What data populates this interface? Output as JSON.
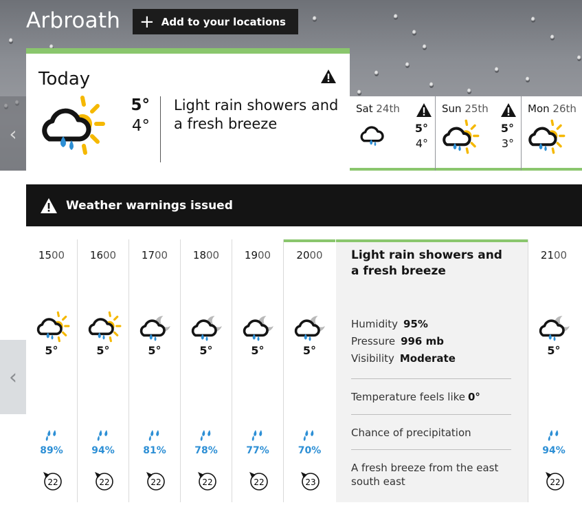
{
  "location": {
    "name": "Arbroath",
    "add_label": "Add to your locations"
  },
  "today": {
    "label": "Today",
    "high": "5°",
    "low": "4°",
    "description": "Light rain showers and a fresh breeze"
  },
  "days": [
    {
      "name": "Sat",
      "date": "24th",
      "high": "5°",
      "low": "4°",
      "warning": true
    },
    {
      "name": "Sun",
      "date": "25th",
      "high": "5°",
      "low": "3°",
      "warning": true
    },
    {
      "name": "Mon",
      "date": "26th",
      "high": "",
      "low": "",
      "warning": false
    }
  ],
  "warnings": {
    "label": "Weather warnings issued"
  },
  "hours": [
    {
      "h": "15",
      "m": "00",
      "temp": "5°",
      "precip": "89%",
      "wind": "22",
      "icon": "sun-rain-icon"
    },
    {
      "h": "16",
      "m": "00",
      "temp": "5°",
      "precip": "94%",
      "wind": "22",
      "icon": "sun-rain-icon"
    },
    {
      "h": "17",
      "m": "00",
      "temp": "5°",
      "precip": "81%",
      "wind": "22",
      "icon": "moon-rain-icon"
    },
    {
      "h": "18",
      "m": "00",
      "temp": "5°",
      "precip": "78%",
      "wind": "22",
      "icon": "moon-rain-icon"
    },
    {
      "h": "19",
      "m": "00",
      "temp": "5°",
      "precip": "77%",
      "wind": "22",
      "icon": "moon-rain-icon"
    },
    {
      "h": "20",
      "m": "00",
      "temp": "5°",
      "precip": "70%",
      "wind": "23",
      "icon": "moon-rain-icon"
    },
    {
      "h": "21",
      "m": "00",
      "temp": "5°",
      "precip": "94%",
      "wind": "22",
      "icon": "moon-rain-icon"
    }
  ],
  "details": {
    "title": "Light rain showers and a fresh breeze",
    "humidity_label": "Humidity",
    "humidity": "95%",
    "pressure_label": "Pressure",
    "pressure": "996 mb",
    "visibility_label": "Visibility",
    "visibility": "Moderate",
    "feels_label": "Temperature feels like",
    "feels": "0°",
    "precip_label": "Chance of precipitation",
    "wind_desc": "A fresh breeze from the east south east"
  },
  "colors": {
    "accent": "#8ac66d",
    "precip": "#2d8fd5",
    "sun": "#f5b800",
    "moon": "#b9b9b9",
    "dark": "#141414"
  }
}
